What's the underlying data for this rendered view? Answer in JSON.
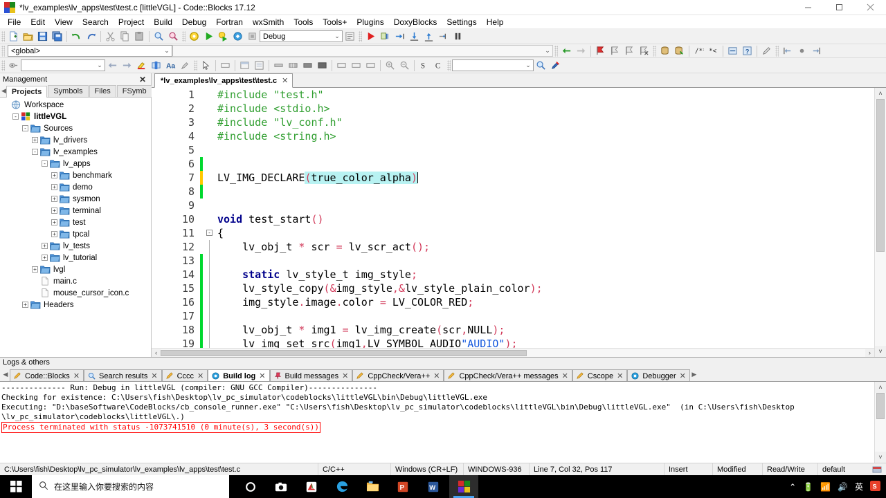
{
  "window": {
    "title": "*lv_examples\\lv_apps\\test\\test.c [littleVGL] - Code::Blocks 17.12",
    "minimize_label": "–",
    "maximize_label": "❐",
    "close_label": "✕"
  },
  "menu": {
    "items": [
      "File",
      "Edit",
      "View",
      "Search",
      "Project",
      "Build",
      "Debug",
      "Fortran",
      "wxSmith",
      "Tools",
      "Tools+",
      "Plugins",
      "DoxyBlocks",
      "Settings",
      "Help"
    ]
  },
  "toolbar": {
    "target_value": "Debug",
    "scope_value": "<global>",
    "search_value": "",
    "find_value": "",
    "dropdown_arrow": "⌄"
  },
  "management": {
    "title": "Management",
    "close_label": "✕",
    "prev_arrow": "◀",
    "next_arrow": "▶",
    "tabs": [
      {
        "label": "Projects",
        "active": true
      },
      {
        "label": "Symbols",
        "active": false
      },
      {
        "label": "Files",
        "active": false
      },
      {
        "label": "FSymb",
        "active": false
      }
    ],
    "tree": [
      {
        "label": "Workspace",
        "indent": 0,
        "icon": "workspace-icon",
        "expander": "",
        "bold": false
      },
      {
        "label": "littleVGL",
        "indent": 1,
        "icon": "project-icon",
        "expander": "-",
        "bold": true
      },
      {
        "label": "Sources",
        "indent": 2,
        "icon": "folder-icon",
        "expander": "-",
        "bold": false
      },
      {
        "label": "lv_drivers",
        "indent": 3,
        "icon": "folder-icon",
        "expander": "+",
        "bold": false
      },
      {
        "label": "lv_examples",
        "indent": 3,
        "icon": "folder-icon",
        "expander": "-",
        "bold": false
      },
      {
        "label": "lv_apps",
        "indent": 4,
        "icon": "folder-icon",
        "expander": "-",
        "bold": false
      },
      {
        "label": "benchmark",
        "indent": 5,
        "icon": "folder-icon",
        "expander": "+",
        "bold": false
      },
      {
        "label": "demo",
        "indent": 5,
        "icon": "folder-icon",
        "expander": "+",
        "bold": false
      },
      {
        "label": "sysmon",
        "indent": 5,
        "icon": "folder-icon",
        "expander": "+",
        "bold": false
      },
      {
        "label": "terminal",
        "indent": 5,
        "icon": "folder-icon",
        "expander": "+",
        "bold": false
      },
      {
        "label": "test",
        "indent": 5,
        "icon": "folder-icon",
        "expander": "+",
        "bold": false
      },
      {
        "label": "tpcal",
        "indent": 5,
        "icon": "folder-icon",
        "expander": "+",
        "bold": false
      },
      {
        "label": "lv_tests",
        "indent": 4,
        "icon": "folder-icon",
        "expander": "+",
        "bold": false
      },
      {
        "label": "lv_tutorial",
        "indent": 4,
        "icon": "folder-icon",
        "expander": "+",
        "bold": false
      },
      {
        "label": "lvgl",
        "indent": 3,
        "icon": "folder-icon",
        "expander": "+",
        "bold": false
      },
      {
        "label": "main.c",
        "indent": 3,
        "icon": "file-icon",
        "expander": "",
        "bold": false
      },
      {
        "label": "mouse_cursor_icon.c",
        "indent": 3,
        "icon": "file-icon",
        "expander": "",
        "bold": false
      },
      {
        "label": "Headers",
        "indent": 2,
        "icon": "folder-icon",
        "expander": "+",
        "bold": false
      }
    ]
  },
  "editor": {
    "tab_label": "*lv_examples\\lv_apps\\test\\test.c",
    "tab_close": "✕",
    "lines": [
      {
        "n": 1,
        "marker": "none",
        "fold": "",
        "segs": [
          {
            "t": "#include ",
            "c": "tk-pre"
          },
          {
            "t": "\"test.h\"",
            "c": "tk-pre"
          }
        ]
      },
      {
        "n": 2,
        "marker": "none",
        "fold": "",
        "segs": [
          {
            "t": "#include ",
            "c": "tk-pre"
          },
          {
            "t": "<stdio.h>",
            "c": "tk-pre"
          }
        ]
      },
      {
        "n": 3,
        "marker": "none",
        "fold": "",
        "segs": [
          {
            "t": "#include ",
            "c": "tk-pre"
          },
          {
            "t": "\"lv_conf.h\"",
            "c": "tk-pre"
          }
        ]
      },
      {
        "n": 4,
        "marker": "none",
        "fold": "",
        "segs": [
          {
            "t": "#include ",
            "c": "tk-pre"
          },
          {
            "t": "<string.h>",
            "c": "tk-pre"
          }
        ]
      },
      {
        "n": 5,
        "marker": "none",
        "fold": "",
        "segs": []
      },
      {
        "n": 6,
        "marker": "green",
        "fold": "",
        "segs": []
      },
      {
        "n": 7,
        "marker": "yellow",
        "fold": "",
        "segs": [
          {
            "t": "LV_IMG_DECLARE",
            "c": ""
          },
          {
            "t": "(",
            "c": "sel tk-op"
          },
          {
            "t": "true_color_alpha",
            "c": "sel"
          },
          {
            "t": ")",
            "c": "sel tk-op"
          }
        ]
      },
      {
        "n": 8,
        "marker": "green",
        "fold": "",
        "segs": []
      },
      {
        "n": 9,
        "marker": "none",
        "fold": "",
        "segs": []
      },
      {
        "n": 10,
        "marker": "none",
        "fold": "",
        "segs": [
          {
            "t": "void",
            "c": "tk-kw"
          },
          {
            "t": " test_start",
            "c": ""
          },
          {
            "t": "()",
            "c": "tk-op"
          }
        ]
      },
      {
        "n": 11,
        "marker": "none",
        "fold": "box",
        "segs": [
          {
            "t": "{",
            "c": ""
          }
        ]
      },
      {
        "n": 12,
        "marker": "none",
        "fold": "stem",
        "segs": [
          {
            "t": "    lv_obj_t ",
            "c": ""
          },
          {
            "t": "*",
            "c": "tk-op"
          },
          {
            "t": " scr ",
            "c": ""
          },
          {
            "t": "=",
            "c": "tk-op"
          },
          {
            "t": " lv_scr_act",
            "c": ""
          },
          {
            "t": "();",
            "c": "tk-op"
          }
        ]
      },
      {
        "n": 13,
        "marker": "green",
        "fold": "stem",
        "segs": []
      },
      {
        "n": 14,
        "marker": "green",
        "fold": "stem",
        "segs": [
          {
            "t": "    ",
            "c": ""
          },
          {
            "t": "static",
            "c": "tk-kw"
          },
          {
            "t": " lv_style_t img_style",
            "c": ""
          },
          {
            "t": ";",
            "c": "tk-op"
          }
        ]
      },
      {
        "n": 15,
        "marker": "green",
        "fold": "stem",
        "segs": [
          {
            "t": "    lv_style_copy",
            "c": ""
          },
          {
            "t": "(",
            "c": "tk-op"
          },
          {
            "t": "&",
            "c": "tk-op"
          },
          {
            "t": "img_style",
            "c": ""
          },
          {
            "t": ",",
            "c": "tk-op"
          },
          {
            "t": "&",
            "c": "tk-op"
          },
          {
            "t": "lv_style_plain_color",
            "c": ""
          },
          {
            "t": ");",
            "c": "tk-op"
          }
        ]
      },
      {
        "n": 16,
        "marker": "green",
        "fold": "stem",
        "segs": [
          {
            "t": "    img_style",
            "c": ""
          },
          {
            "t": ".",
            "c": "tk-op"
          },
          {
            "t": "image",
            "c": ""
          },
          {
            "t": ".",
            "c": "tk-op"
          },
          {
            "t": "color ",
            "c": ""
          },
          {
            "t": "=",
            "c": "tk-op"
          },
          {
            "t": " LV_COLOR_RED",
            "c": ""
          },
          {
            "t": ";",
            "c": "tk-op"
          }
        ]
      },
      {
        "n": 17,
        "marker": "green",
        "fold": "stem",
        "segs": []
      },
      {
        "n": 18,
        "marker": "green",
        "fold": "stem",
        "segs": [
          {
            "t": "    lv_obj_t ",
            "c": ""
          },
          {
            "t": "*",
            "c": "tk-op"
          },
          {
            "t": " img1 ",
            "c": ""
          },
          {
            "t": "=",
            "c": "tk-op"
          },
          {
            "t": " lv_img_create",
            "c": ""
          },
          {
            "t": "(",
            "c": "tk-op"
          },
          {
            "t": "scr",
            "c": ""
          },
          {
            "t": ",",
            "c": "tk-op"
          },
          {
            "t": "NULL",
            "c": ""
          },
          {
            "t": ");",
            "c": "tk-op"
          }
        ]
      },
      {
        "n": 19,
        "marker": "green",
        "fold": "stem",
        "segs": [
          {
            "t": "    lv_img_set_src",
            "c": ""
          },
          {
            "t": "(",
            "c": "tk-op"
          },
          {
            "t": "img1",
            "c": ""
          },
          {
            "t": ",",
            "c": "tk-op"
          },
          {
            "t": "LV_SYMBOL_AUDIO",
            "c": ""
          },
          {
            "t": "\"AUDIO\"",
            "c": "tk-str"
          },
          {
            "t": ");",
            "c": "tk-op"
          }
        ]
      }
    ],
    "scroll_up": "˄",
    "scroll_down": "˅",
    "scroll_left": "‹",
    "scroll_right": "›"
  },
  "logs": {
    "title": "Logs & others",
    "prev_arrow": "◀",
    "next_arrow": "▶",
    "close_label": "✕",
    "tabs": [
      {
        "label": "Code::Blocks",
        "icon": "pencil-icon",
        "active": false
      },
      {
        "label": "Search results",
        "icon": "magnifier-icon",
        "active": false
      },
      {
        "label": "Cccc",
        "icon": "pencil-icon",
        "active": false
      },
      {
        "label": "Build log",
        "icon": "circle-icon",
        "active": true
      },
      {
        "label": "Build messages",
        "icon": "pin-icon",
        "active": false
      },
      {
        "label": "CppCheck/Vera++",
        "icon": "pencil-icon",
        "active": false
      },
      {
        "label": "CppCheck/Vera++ messages",
        "icon": "pencil-icon",
        "active": false
      },
      {
        "label": "Cscope",
        "icon": "pencil-icon",
        "active": false
      },
      {
        "label": "Debugger",
        "icon": "circle-icon",
        "active": false
      }
    ],
    "content_lines": [
      "-------------- Run: Debug in littleVGL (compiler: GNU GCC Compiler)---------------",
      "",
      "Checking for existence: C:\\Users\\fish\\Desktop\\lv_pc_simulator\\codeblocks\\littleVGL\\bin\\Debug\\littleVGL.exe",
      "Executing: \"D:\\baseSoftware\\CodeBlocks/cb_console_runner.exe\" \"C:\\Users\\fish\\Desktop\\lv_pc_simulator\\codeblocks\\littleVGL\\bin\\Debug\\littleVGL.exe\"  (in C:\\Users\\fish\\Desktop",
      "\\lv_pc_simulator\\codeblocks\\littleVGL\\.)"
    ],
    "error_line": "Process terminated with status -1073741510 (0 minute(s), 3 second(s))"
  },
  "status_bar": {
    "path": "C:\\Users\\fish\\Desktop\\lv_pc_simulator\\lv_examples\\lv_apps\\test\\test.c",
    "language": "C/C++",
    "eol": "Windows (CR+LF)",
    "encoding": "WINDOWS-936",
    "position": "Line 7, Col 32, Pos 117",
    "mode": "Insert",
    "modified": "Modified",
    "access": "Read/Write",
    "profile": "default"
  },
  "taskbar": {
    "start_label": "start-button",
    "search_placeholder": "在这里输入你要搜索的内容",
    "items": [
      {
        "name": "cortana-icon",
        "active": false
      },
      {
        "name": "camera-icon",
        "active": false
      },
      {
        "name": "pdf-icon",
        "active": false
      },
      {
        "name": "edge-icon",
        "active": false
      },
      {
        "name": "file-explorer-icon",
        "active": false
      },
      {
        "name": "powerpoint-icon",
        "active": false
      },
      {
        "name": "word-icon",
        "active": false
      },
      {
        "name": "codeblocks-icon",
        "active": true
      }
    ],
    "tray": [
      "⌃",
      "🔋",
      "📶",
      "🔊",
      "英"
    ]
  },
  "colors": {
    "accent": "#4aa3f0",
    "error": "#ff0000",
    "preprocessor": "#2f9e2f",
    "keyword": "#00008b",
    "string": "#1155dd",
    "operator": "#d23a5a",
    "selection": "#b8f2f2",
    "change_unsaved": "#ffc800",
    "change_saved": "#00d82e"
  }
}
